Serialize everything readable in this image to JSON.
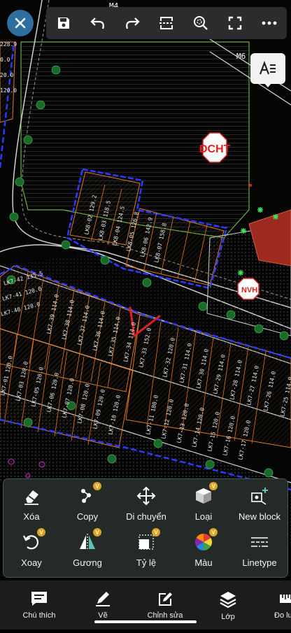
{
  "map": {
    "road_labels": [
      "M4",
      "M6"
    ],
    "building_labels": [
      "ĐCHT",
      "NVH"
    ],
    "row_top": [
      "LK8-02 129.2",
      "LK8-03 118.5",
      "LK8-04 124.5",
      "LK8-05 126.8",
      "LK8-06 142.9",
      "LK8-07 158.8"
    ],
    "row_mid_left": [
      "LK7-42 135.5",
      "LK7-41 120.0",
      "LK7-40 120.0"
    ],
    "row_mid": [
      "LK7-39 114.0",
      "LK7-38 114.0",
      "LK7-37 114.0",
      "LK7-36 114.0",
      "LK7-35 114.0",
      "LK7-34 114.0",
      "LK7-33 152.0"
    ],
    "row_lower_left": [
      "LK7-01 120.0",
      "LK7-03 120.0",
      "LK7-05 120.0",
      "LK7-06 120.0",
      "LK7-07 120.0",
      "LK7-08 120.0",
      "LK7-09 120.0",
      "LK7-10 120.0"
    ],
    "row_lower_right": [
      "LK7-11 180.0",
      "LK7-12 120.0",
      "LK7-13 120.0",
      "LK7-14 120.0",
      "LK7-15 120.0",
      "LK7-16 120.0",
      "LK7-17 120.0"
    ],
    "row_right": [
      "LK7-32 120.0",
      "LK7-31 114.0",
      "LK7-30 114.0",
      "LK7-29 114.0",
      "LK7-28 114.0",
      "LK7-27 114.0",
      "LK7-26 114.0",
      "LK7-25 114.0"
    ],
    "left_edge": [
      "228.9",
      "0.0",
      "20.0",
      "120.0"
    ]
  },
  "toolbar": {
    "close": "close-icon",
    "items": [
      "save-icon",
      "undo-icon",
      "redo-icon",
      "split-icon",
      "zoom-icon",
      "fullscreen-icon",
      "more-icon"
    ],
    "side": "text-style-icon"
  },
  "tools": [
    {
      "label": "Xóa",
      "icon": "eraser-icon",
      "badge": ""
    },
    {
      "label": "Copy",
      "icon": "copy-nodes-icon",
      "badge": "V"
    },
    {
      "label": "Di chuyển",
      "icon": "move-icon",
      "badge": ""
    },
    {
      "label": "Loại",
      "icon": "cube-icon",
      "badge": "V"
    },
    {
      "label": "New block",
      "icon": "new-block-icon",
      "badge": ""
    },
    {
      "label": "Xoay",
      "icon": "rotate-icon",
      "badge": "V"
    },
    {
      "label": "Gương",
      "icon": "mirror-icon",
      "badge": "V"
    },
    {
      "label": "Tỷ lệ",
      "icon": "scale-icon",
      "badge": "V"
    },
    {
      "label": "Màu",
      "icon": "color-wheel-icon",
      "badge": "V"
    },
    {
      "label": "Linetype",
      "icon": "linetype-icon",
      "badge": ""
    }
  ],
  "nav": [
    {
      "label": "Chú thích",
      "icon": "comment-icon"
    },
    {
      "label": "Vẽ",
      "icon": "pencil-icon"
    },
    {
      "label": "Chỉnh sửa",
      "icon": "edit-icon"
    },
    {
      "label": "Lớp",
      "icon": "layers-icon"
    },
    {
      "label": "Đo lư",
      "icon": "ruler-icon"
    }
  ],
  "colors": {
    "accent": "#2f6f9f",
    "badge": "#e0a322",
    "plot_outline": "#e07a1e",
    "boundary": "#2a3cff",
    "road_line": "#e8e8e8",
    "panel_border": "#3c5d4c"
  }
}
